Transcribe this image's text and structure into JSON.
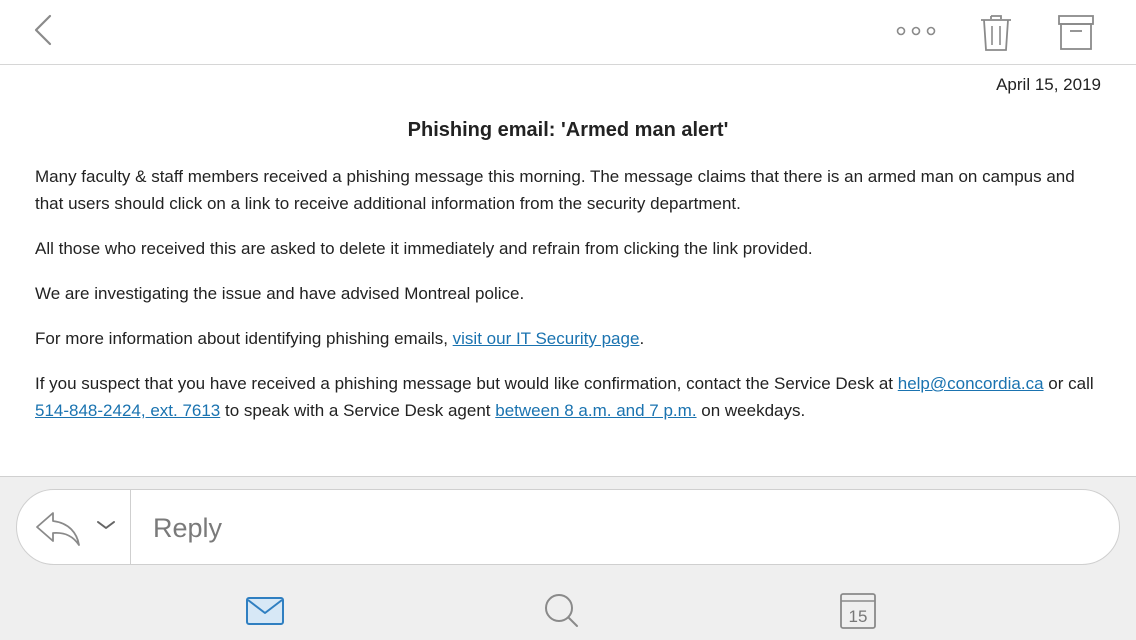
{
  "toolbar": {
    "back_icon": "chevron-left-icon",
    "more_icon": "more-dots-icon",
    "trash_icon": "trash-icon",
    "archive_icon": "archive-icon"
  },
  "message": {
    "date": "April 15, 2019",
    "title": "Phishing email: 'Armed man alert'",
    "p1": "Many faculty & staff members received a phishing message this morning. The message claims that there is an armed man on campus and that users should click on a link to receive additional information from the security department.",
    "p2": "All those who received this are asked to delete it immediately and refrain from clicking the link provided.",
    "p3": "We are investigating the issue and have advised Montreal police.",
    "p4_prefix": "For more information about identifying phishing emails, ",
    "p4_link": "visit our IT Security page",
    "p4_suffix": ".",
    "p5_part1": "If you suspect that you have received a phishing message but would like confirmation, contact the Service Desk at ",
    "p5_email": "help@concordia.ca",
    "p5_part2": " or call ",
    "p5_phone": "514-848-2424, ext. 7613",
    "p5_part3": " to speak with a Service Desk agent ",
    "p5_hours": "between 8 a.m. and 7 p.m.",
    "p5_part4": " on weekdays."
  },
  "reply": {
    "placeholder": "Reply",
    "reply_icon": "reply-arrow-icon",
    "chevron_icon": "chevron-down-icon"
  },
  "tabs": {
    "mail_icon": "mail-icon",
    "search_icon": "search-icon",
    "calendar_icon": "calendar-icon",
    "calendar_day": "15"
  },
  "colors": {
    "link": "#1a73b0",
    "accent_blue": "#2f7fc1",
    "icon_gray": "#8a8a8a"
  }
}
